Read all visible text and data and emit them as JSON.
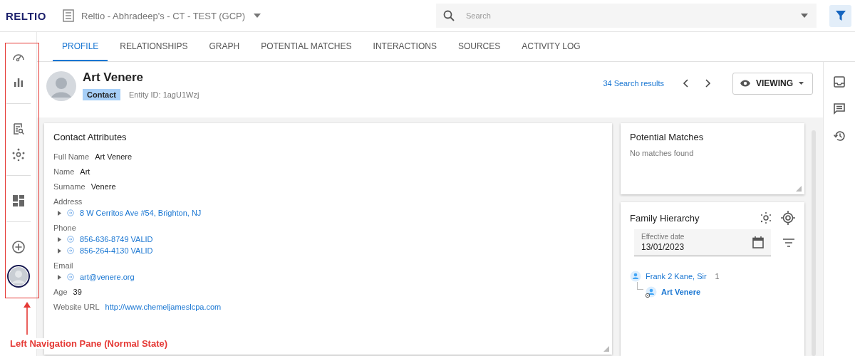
{
  "header": {
    "logo": "RELTIO",
    "tenant": "Reltio - Abhradeep's - CT - TEST (GCP)",
    "search": {
      "placeholder": "Search"
    }
  },
  "left_nav": {
    "groups": [
      {
        "items": [
          {
            "kind": "icon"
          },
          {
            "kind": "icon"
          }
        ]
      },
      {
        "items": [
          {
            "kind": "icon"
          },
          {
            "kind": "icon"
          }
        ]
      },
      {
        "items": [
          {
            "kind": "icon"
          }
        ]
      },
      {
        "items": [
          {
            "kind": "icon"
          },
          {
            "kind": "avatar"
          }
        ]
      }
    ]
  },
  "tabs": [
    {
      "label": "PROFILE",
      "selected": true
    },
    {
      "label": "RELATIONSHIPS",
      "selected": false
    },
    {
      "label": "GRAPH",
      "selected": false
    },
    {
      "label": "POTENTIAL MATCHES",
      "selected": false
    },
    {
      "label": "INTERACTIONS",
      "selected": false
    },
    {
      "label": "SOURCES",
      "selected": false
    },
    {
      "label": "ACTIVITY LOG",
      "selected": false
    }
  ],
  "entity": {
    "name": "Art Venere",
    "type_badge": "Contact",
    "entity_id": "Entity ID: 1agU1Wzj",
    "search_results": "34 Search results",
    "mode_button": "VIEWING"
  },
  "contact_attributes": {
    "title": "Contact Attributes",
    "attributes": [
      {
        "kind": "inline",
        "label": "Full Name",
        "value": "Art Venere"
      },
      {
        "kind": "inline",
        "label": "Name",
        "value": "Art"
      },
      {
        "kind": "inline",
        "label": "Surname",
        "value": "Venere"
      },
      {
        "kind": "list",
        "label": "Address",
        "values": [
          "8 W Cerritos Ave #54, Brighton, NJ"
        ]
      },
      {
        "kind": "list",
        "label": "Phone",
        "values": [
          "856-636-8749 VALID",
          "856-264-4130 VALID"
        ]
      },
      {
        "kind": "list",
        "label": "Email",
        "values": [
          "art@venere.org"
        ]
      },
      {
        "kind": "inline",
        "label": "Age",
        "value": "39"
      },
      {
        "kind": "link",
        "label": "Website URL",
        "value": "http://www.chemeljameslcpa.com"
      }
    ]
  },
  "potential_matches": {
    "title": "Potential Matches",
    "message": "No matches found"
  },
  "family_hierarchy": {
    "title": "Family Hierarchy",
    "date_field": {
      "label": "Effective date",
      "value": "13/01/2023"
    },
    "tree": [
      {
        "name": "Frank 2 Kane, Sir",
        "count": "1",
        "current": false,
        "children": [
          {
            "name": "Art Venere",
            "current": true
          }
        ]
      }
    ]
  },
  "annotation": {
    "label": "Left Navigation Pane (Normal State)"
  }
}
